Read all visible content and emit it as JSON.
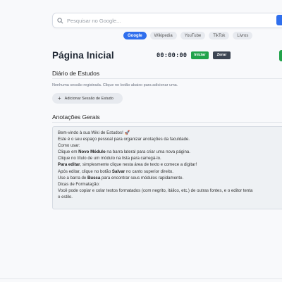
{
  "search": {
    "placeholder": "Pesquisar no Google..."
  },
  "engines": [
    {
      "label": "Google",
      "active": true
    },
    {
      "label": "Wikipedia",
      "active": false
    },
    {
      "label": "YouTube",
      "active": false
    },
    {
      "label": "TikTok",
      "active": false
    },
    {
      "label": "Livros",
      "active": false
    }
  ],
  "page": {
    "title": "Página Inicial"
  },
  "timer": {
    "display": "00:00:00",
    "start_label": "Iniciar",
    "reset_label": "Zerar"
  },
  "diary": {
    "title": "Diário de Estudos",
    "empty_message": "Nenhuma sessão registrada. Clique no botão abaixo para adicionar uma.",
    "add_label": "Adicionar Sessão de Estudo"
  },
  "notes": {
    "title": "Anotações Gerais",
    "lines": [
      {
        "pre": "Bem-vindo à sua Wiki de Estudos! 🚀",
        "bold": "",
        "post": ""
      },
      {
        "pre": "Este é o seu espaço pessoal para organizar anotações da faculdade.",
        "bold": "",
        "post": ""
      },
      {
        "pre": "Como usar:",
        "bold": "",
        "post": ""
      },
      {
        "pre": "Clique em ",
        "bold": "Novo Módulo",
        "post": " na barra lateral para criar uma nova página."
      },
      {
        "pre": "Clique no título de um módulo na lista para carregá-lo.",
        "bold": "",
        "post": ""
      },
      {
        "pre": "",
        "bold": "Para editar",
        "post": ", simplesmente clique nesta área de texto e comece a digitar!"
      },
      {
        "pre": "Após editar, clique no botão ",
        "bold": "Salvar",
        "post": " no canto superior direito."
      },
      {
        "pre": "Use a barra de ",
        "bold": "Busca",
        "post": " para encontrar seus módulos rapidamente."
      },
      {
        "pre": "Dicas de Formatação:",
        "bold": "",
        "post": ""
      },
      {
        "pre": "Você pode copiar e colar textos formatados (com negrito, itálico, etc.) de outras fontes, e o editor tenta",
        "bold": "",
        "post": ""
      },
      {
        "pre": "o estilo.",
        "bold": "",
        "post": ""
      }
    ]
  },
  "colors": {
    "accent": "#2f6fed",
    "start": "#22a34b",
    "reset": "#3c4552",
    "background": "#f8f9fb"
  }
}
